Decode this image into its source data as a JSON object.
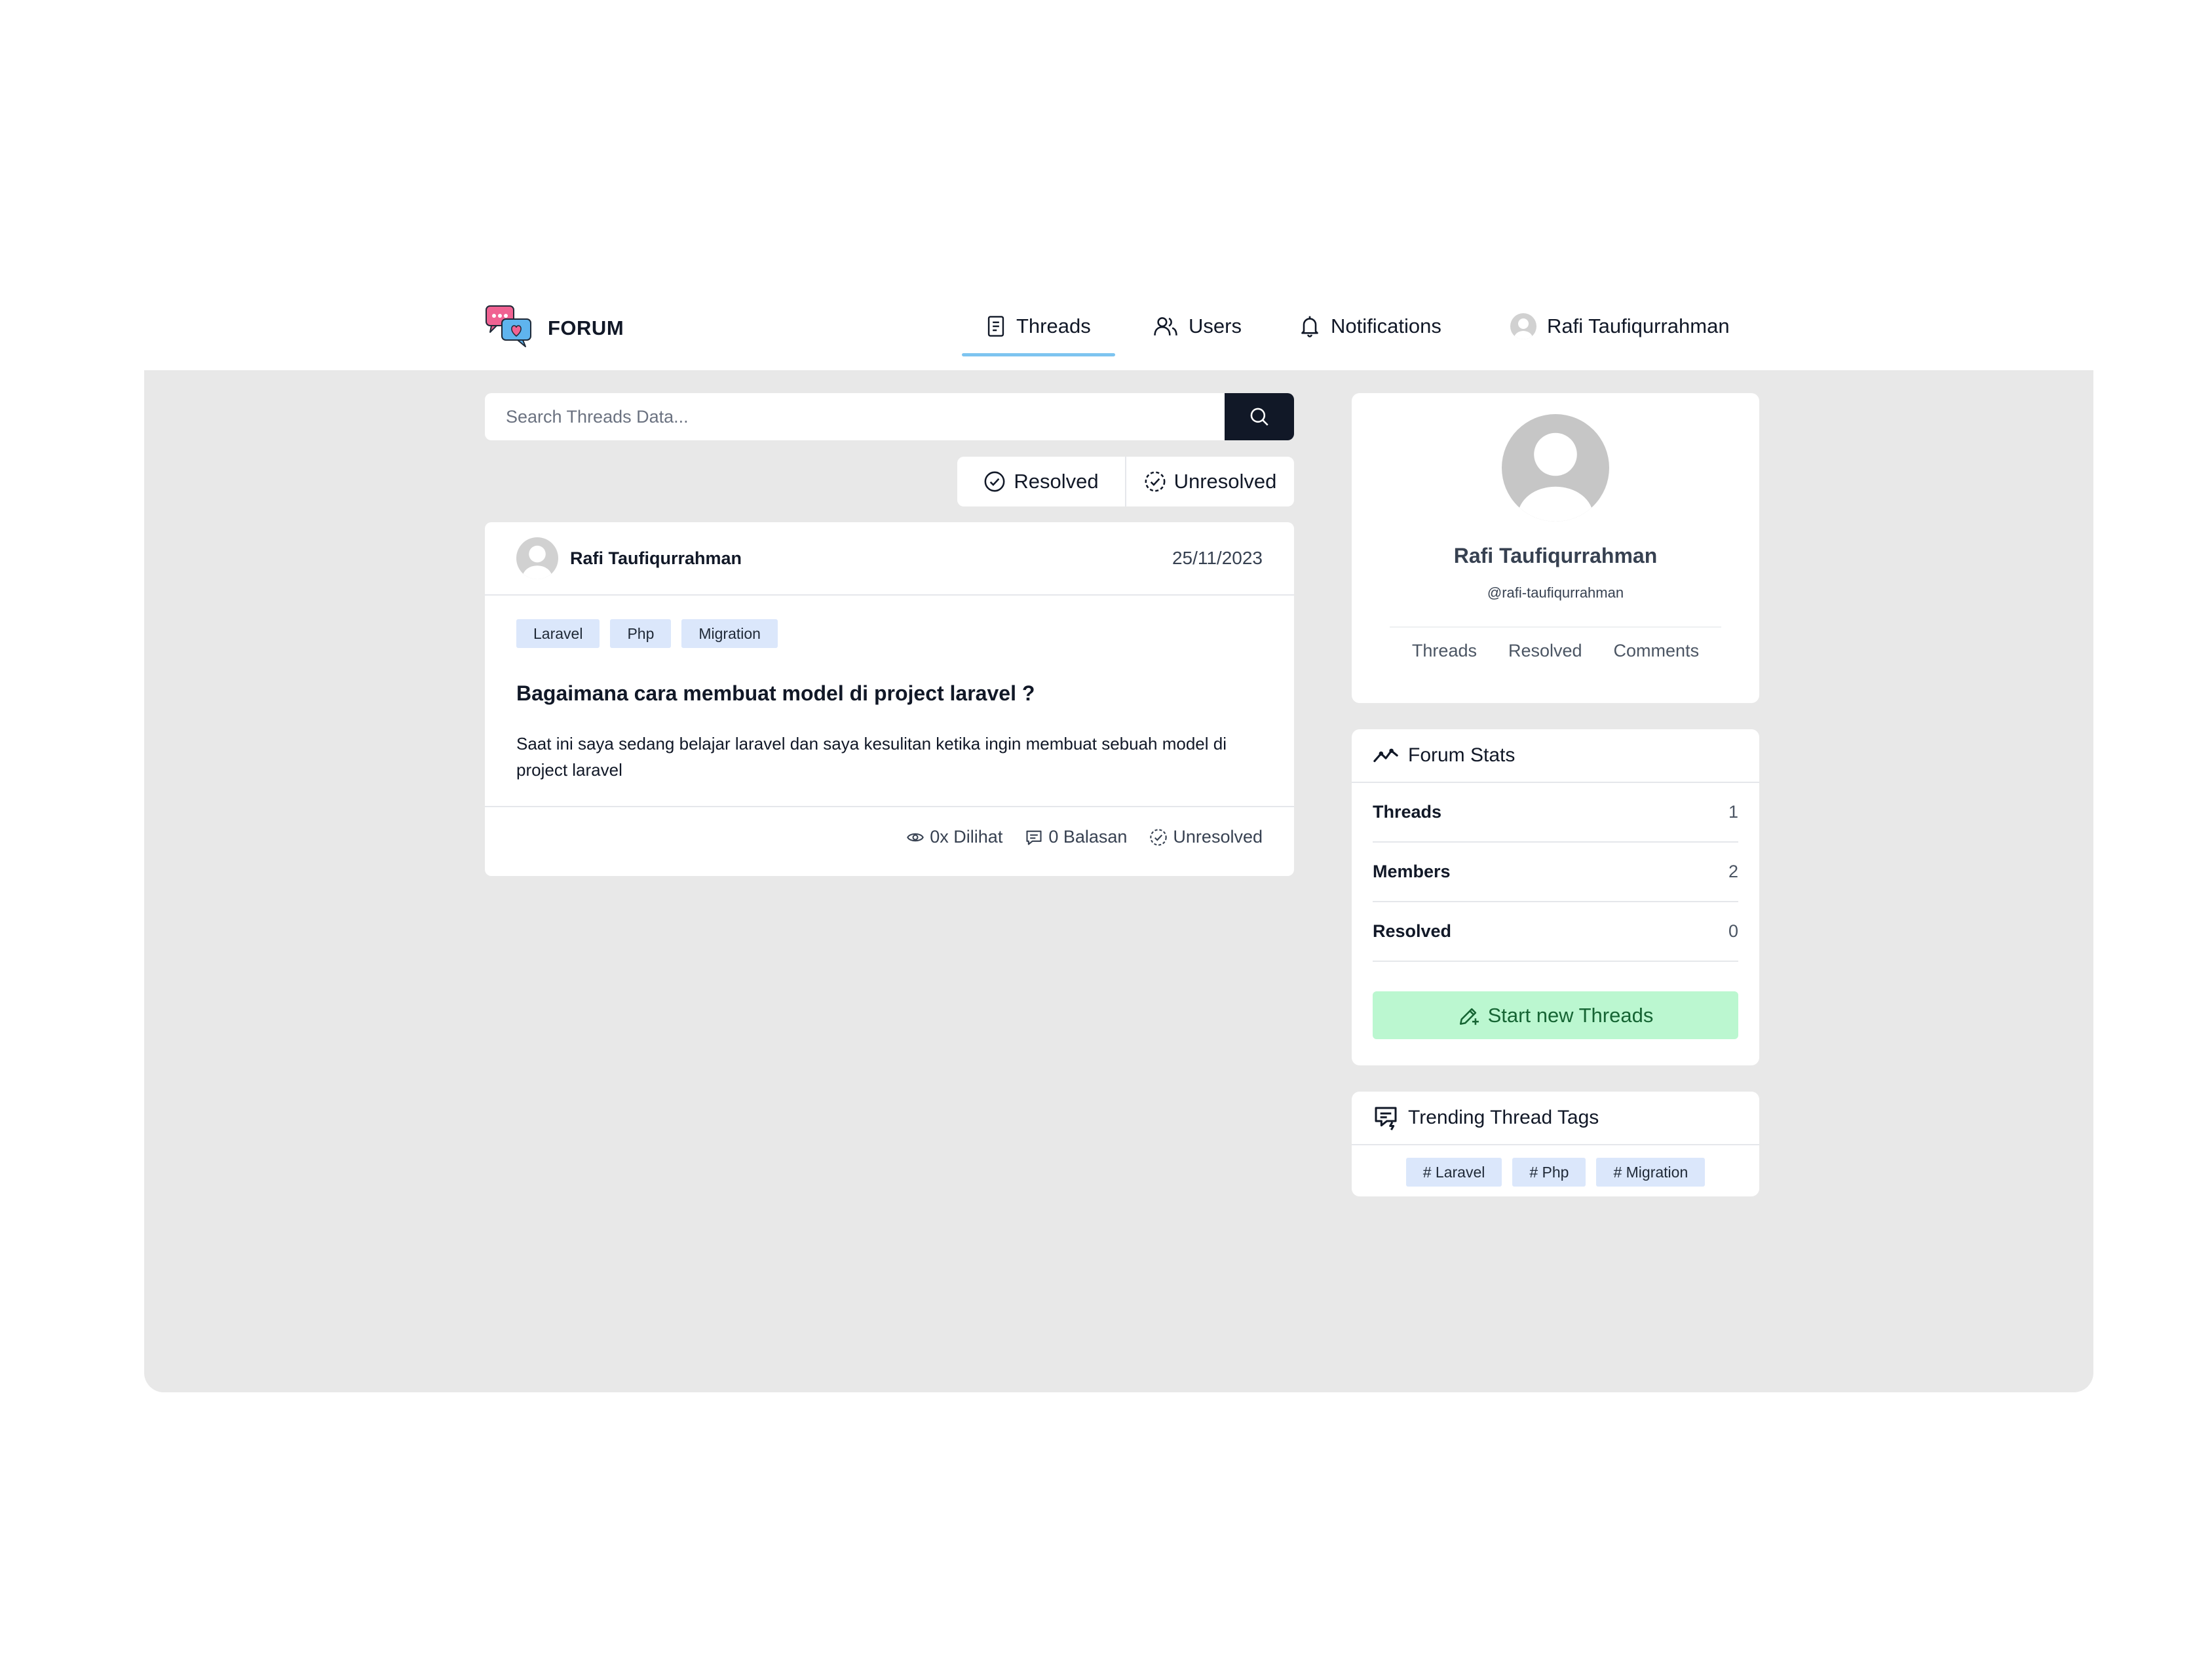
{
  "brand": {
    "name": "FORUM"
  },
  "nav": {
    "threads": "Threads",
    "users": "Users",
    "notifications": "Notifications",
    "profile": "Rafi Taufiqurrahman",
    "active": "Threads"
  },
  "search": {
    "placeholder": "Search Threads Data..."
  },
  "filters": {
    "resolved": "Resolved",
    "unresolved": "Unresolved"
  },
  "thread": {
    "author": "Rafi Taufiqurrahman",
    "date": "25/11/2023",
    "tags": [
      "Laravel",
      "Php",
      "Migration"
    ],
    "title": "Bagaimana cara membuat model di project laravel ?",
    "body": "Saat ini saya sedang belajar laravel dan saya kesulitan ketika ingin membuat sebuah model di project laravel",
    "views": "0x Dilihat",
    "replies": "0 Balasan",
    "status": "Unresolved"
  },
  "profile": {
    "name": "Rafi Taufiqurrahman",
    "handle": "@rafi-taufiqurrahman",
    "tabs": [
      "Threads",
      "Resolved",
      "Comments"
    ]
  },
  "stats": {
    "title": "Forum Stats",
    "rows": [
      {
        "label": "Threads",
        "value": "1"
      },
      {
        "label": "Members",
        "value": "2"
      },
      {
        "label": "Resolved",
        "value": "0"
      }
    ],
    "button": "Start new Threads"
  },
  "trending": {
    "title": "Trending Thread Tags",
    "tags": [
      "# Laravel",
      "# Php",
      "# Migration"
    ]
  },
  "colors": {
    "accent_underline": "#7dc4f0",
    "search_button": "#111827",
    "tag_bg": "#dbe7fb",
    "start_button_bg": "#bbf7d0",
    "start_button_text": "#166534",
    "page_bg": "#e8e8e8"
  },
  "icons": {
    "brand": "chat-bubbles-heart-icon",
    "threads": "document-icon",
    "users": "users-icon",
    "notifications": "bell-icon",
    "search": "search-icon",
    "resolved": "check-circle-icon",
    "unresolved": "dashed-check-circle-icon",
    "views": "eye-icon",
    "replies": "comment-icon",
    "stats": "trend-line-icon",
    "start": "pencil-plus-icon",
    "trending": "message-bolt-icon"
  }
}
